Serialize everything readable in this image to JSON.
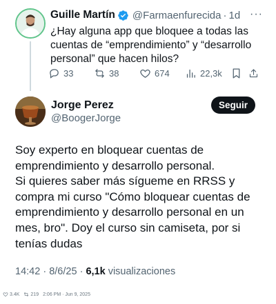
{
  "parent_tweet": {
    "author_name": "Guille Martín",
    "author_handle": "@Farmaenfurecida",
    "dot": "·",
    "time": "1d",
    "more_glyph": "···",
    "text_lines": [
      "¿Hay alguna app que bloquee a todas las",
      "cuentas de “emprendimiento” y “desarrollo",
      "personal” que hacen hilos?"
    ],
    "replies": "33",
    "reposts": "38",
    "likes": "674",
    "views": "22,3k",
    "verified_color": "#1d9bf0"
  },
  "main_tweet": {
    "author_name": "Jorge Perez",
    "author_handle": "@BoogerJorge",
    "follow_label": "Seguir",
    "text_lines": [
      "Soy experto en bloquear cuentas de",
      "emprendimiento y desarrollo personal.",
      "Si quieres saber más sígueme en RRSS y",
      "compra mi curso \"Cómo bloquear cuentas de",
      "emprendimiento y desarrollo personal en un",
      "mes, bro\". Doy el curso sin camiseta, por si",
      "tenías dudas"
    ],
    "time": "14:42",
    "date": "8/6/25",
    "dot": "·",
    "views_count": "6,1k",
    "views_label": "visualizaciones"
  },
  "overlay_footer": {
    "likes": "3.4K",
    "reposts": "219",
    "timestamp": "2:06 PM · Jun 9, 2025"
  },
  "colors": {
    "text_primary": "#0f1419",
    "text_secondary": "#536471",
    "thread_line": "#cfd9de",
    "follow_bg": "#0f1419"
  }
}
